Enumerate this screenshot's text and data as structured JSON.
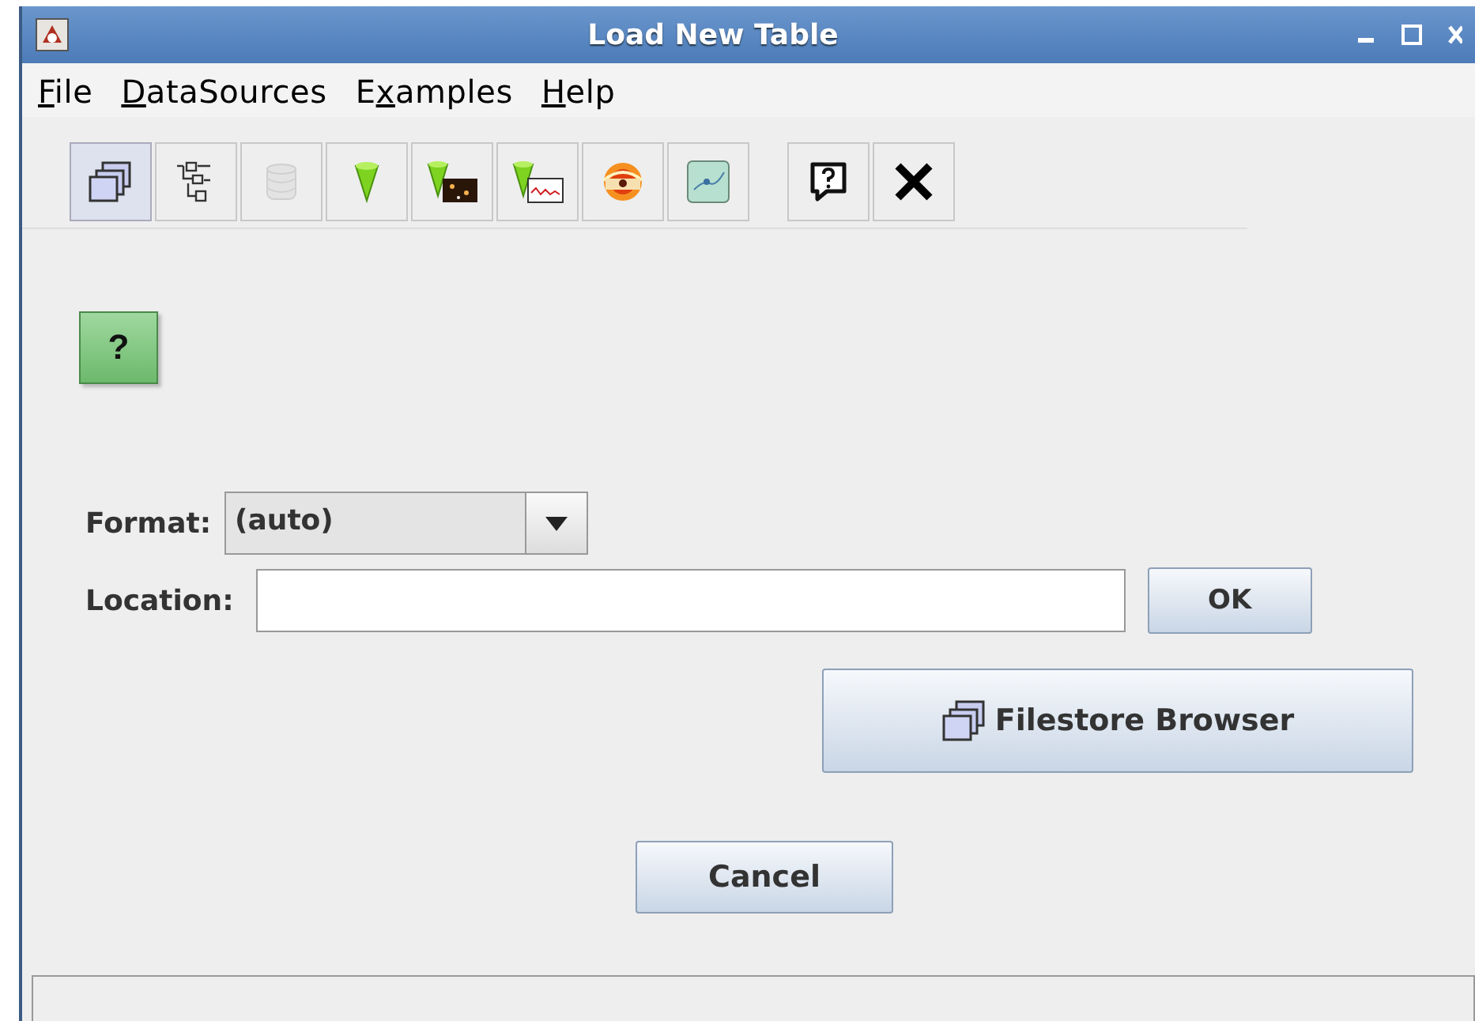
{
  "window": {
    "title": "Load New Table"
  },
  "menu": [
    {
      "key": "F",
      "after": "ile"
    },
    {
      "key": "D",
      "after": "ataSources"
    },
    {
      "before": "E",
      "key": "x",
      "after": "amples"
    },
    {
      "key": "H",
      "after": "elp"
    }
  ],
  "toolbar": [
    {
      "kind": "filestore",
      "selected": true,
      "disabled": false
    },
    {
      "kind": "hierarchy",
      "selected": false,
      "disabled": false
    },
    {
      "kind": "database",
      "selected": false,
      "disabled": true
    },
    {
      "kind": "cone",
      "selected": false,
      "disabled": false
    },
    {
      "kind": "cone-image",
      "selected": false,
      "disabled": false
    },
    {
      "kind": "cone-plot",
      "selected": false,
      "disabled": false
    },
    {
      "kind": "swirl",
      "selected": false,
      "disabled": false
    },
    {
      "kind": "map",
      "selected": false,
      "disabled": false
    },
    {
      "kind": "gap"
    },
    {
      "kind": "help",
      "selected": false,
      "disabled": false
    },
    {
      "kind": "close",
      "selected": false,
      "disabled": false
    }
  ],
  "help_button": {
    "label": "?"
  },
  "format": {
    "label": "Format:",
    "value": "(auto)"
  },
  "location": {
    "label": "Location:",
    "ok": "OK"
  },
  "filestore_button": {
    "label": "Filestore Browser"
  },
  "cancel_button": {
    "label": "Cancel"
  }
}
